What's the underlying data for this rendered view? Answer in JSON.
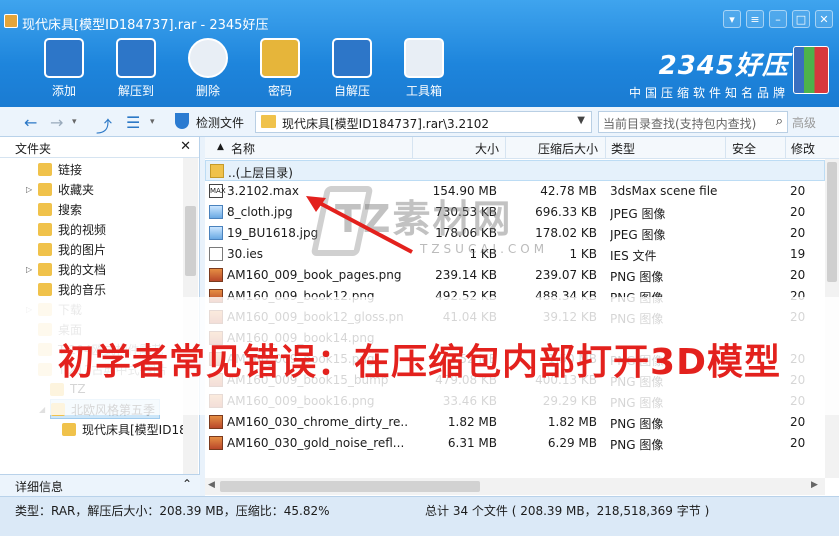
{
  "window": {
    "title": "现代床具[模型ID184737].rar - 2345好压"
  },
  "toolbar": [
    {
      "label": "添加",
      "icon": "add-icon"
    },
    {
      "label": "解压到",
      "icon": "extract-to-icon"
    },
    {
      "label": "删除",
      "icon": "delete-icon"
    },
    {
      "label": "密码",
      "icon": "password-lock-icon"
    },
    {
      "label": "自解压",
      "icon": "self-extract-icon"
    },
    {
      "label": "工具箱",
      "icon": "toolbox-icon"
    }
  ],
  "brand": {
    "name": "2345好压",
    "slogan": "中国压缩软件知名品牌"
  },
  "nav": {
    "detect_label": "检测文件",
    "path": "现代床具[模型ID184737].rar\\3.2102",
    "search_placeholder": "当前目录查找(支持包内查找)",
    "advanced": "高级"
  },
  "left": {
    "header": "文件夹",
    "items": [
      {
        "label": "链接"
      },
      {
        "label": "收藏夹"
      },
      {
        "label": "搜索"
      },
      {
        "label": "我的视频"
      },
      {
        "label": "我的图片"
      },
      {
        "label": "我的文档"
      },
      {
        "label": "我的音乐"
      },
      {
        "label": "下载"
      },
      {
        "label": "桌面"
      },
      {
        "label": "T-204欧式构件雕花"
      },
      {
        "label": "T-211古典中式-图片"
      },
      {
        "label": "TZ"
      },
      {
        "label": "北欧风格第五季"
      },
      {
        "label": "现代床具[模型ID18"
      }
    ],
    "footer": "详细信息"
  },
  "list": {
    "columns": {
      "name": "名称",
      "size": "大小",
      "compressed": "压缩后大小",
      "type": "类型",
      "security": "安全",
      "modified": "修改"
    },
    "parent": "..(上层目录)",
    "rows": [
      {
        "name": "3.2102.max",
        "size": "154.90 MB",
        "comp": "42.78 MB",
        "type": "3dsMax scene file",
        "extra": "20",
        "icon": "max"
      },
      {
        "name": "8_cloth.jpg",
        "size": "730.53 KB",
        "comp": "696.33 KB",
        "type": "JPEG 图像",
        "extra": "20",
        "icon": "img"
      },
      {
        "name": "19_BU1618.jpg",
        "size": "178.06 KB",
        "comp": "178.02 KB",
        "type": "JPEG 图像",
        "extra": "20",
        "icon": "img"
      },
      {
        "name": "30.ies",
        "size": "1 KB",
        "comp": "1 KB",
        "type": "IES 文件",
        "extra": "19",
        "icon": "file"
      },
      {
        "name": "AM160_009_book_pages.png",
        "size": "239.14 KB",
        "comp": "239.07 KB",
        "type": "PNG 图像",
        "extra": "20",
        "icon": "png"
      },
      {
        "name": "AM160_009_book12.png",
        "size": "492.52 KB",
        "comp": "488.34 KB",
        "type": "PNG 图像",
        "extra": "20",
        "icon": "png"
      },
      {
        "name": "AM160_009_book12_gloss.pn",
        "size": "41.04 KB",
        "comp": "39.12 KB",
        "type": "PNG 图像",
        "extra": "20",
        "icon": "png"
      },
      {
        "name": "AM160_009_book14.png",
        "size": "",
        "comp": "",
        "type": "",
        "extra": "",
        "icon": "png"
      },
      {
        "name": "AM160_009_book15.png",
        "size": "1.52 MB",
        "comp": "1.50 MB",
        "type": "PNG 图像",
        "extra": "20",
        "icon": "png"
      },
      {
        "name": "AM160_009_book15_bump",
        "size": "479.08 KB",
        "comp": "400.13 KB",
        "type": "PNG 图像",
        "extra": "20",
        "icon": "png"
      },
      {
        "name": "AM160_009_book16.png",
        "size": "33.46 KB",
        "comp": "29.29 KB",
        "type": "PNG 图像",
        "extra": "20",
        "icon": "png"
      },
      {
        "name": "AM160_030_chrome_dirty_re...",
        "size": "1.82 MB",
        "comp": "1.82 MB",
        "type": "PNG 图像",
        "extra": "20",
        "icon": "png"
      },
      {
        "name": "AM160_030_gold_noise_refl...",
        "size": "6.31 MB",
        "comp": "6.29 MB",
        "type": "PNG 图像",
        "extra": "20",
        "icon": "png"
      }
    ]
  },
  "status": {
    "left": "类型：RAR，解压后大小：208.39 MB，压缩比：45.82%",
    "right": "总计 34 个文件 ( 208.39 MB，218,518,369 字节 )"
  },
  "overlay": {
    "watermark": "TZ素材网",
    "watermark_sub": "TZSUCAI.COM",
    "banner": "初学者常见错误：在压缩包内部打开3D模型"
  },
  "colors": {
    "banner_text": "#e3211d",
    "titlebar": "#1e85dc"
  }
}
